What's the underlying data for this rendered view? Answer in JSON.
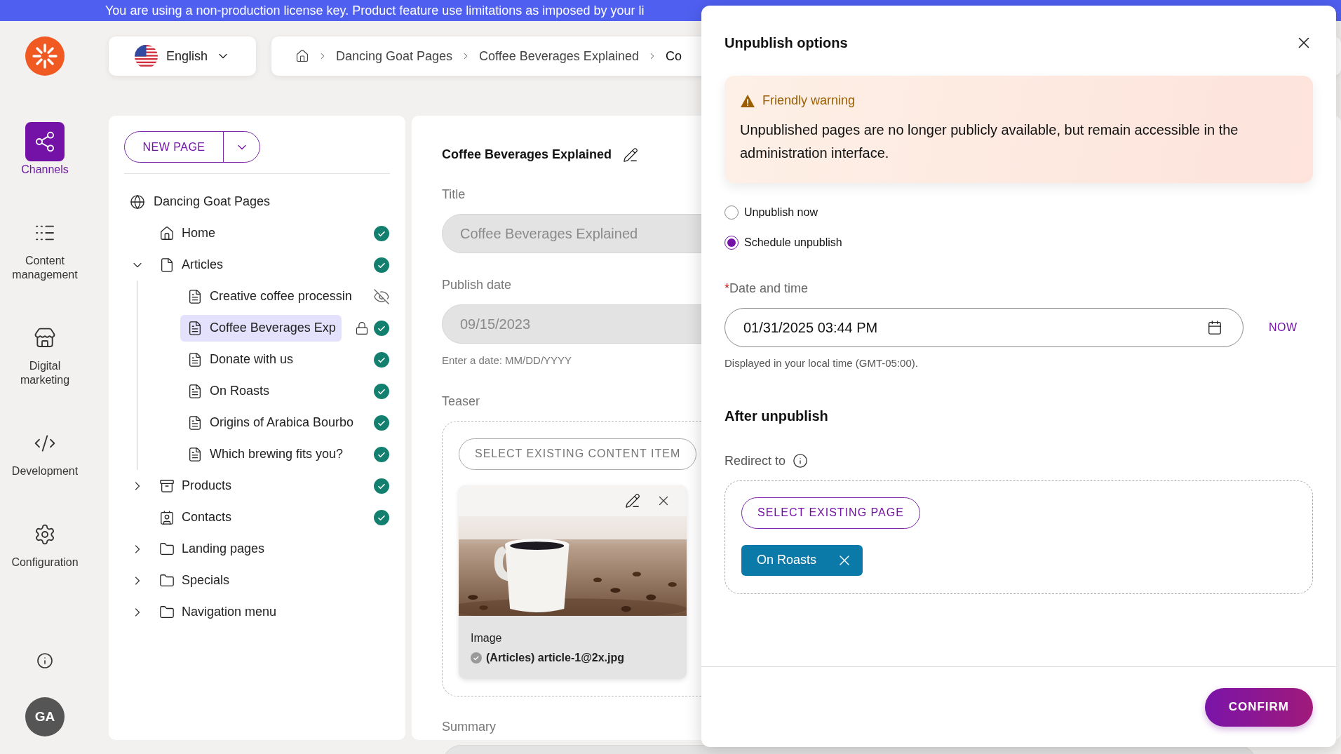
{
  "banner": {
    "text": "You are using a non-production license key. Product feature use limitations as imposed by your li"
  },
  "rail": {
    "items": [
      {
        "label": "Channels",
        "kind": "channels",
        "selected": true
      },
      {
        "label": "Content management",
        "kind": "content",
        "selected": false
      },
      {
        "label": "Digital marketing",
        "kind": "store",
        "selected": false
      },
      {
        "label": "Development",
        "kind": "code",
        "selected": false
      },
      {
        "label": "Configuration",
        "kind": "gears",
        "selected": false
      }
    ],
    "avatar": "GA"
  },
  "language": {
    "label": "English"
  },
  "breadcrumb": [
    "Dancing Goat Pages",
    "Coffee Beverages Explained",
    "Co"
  ],
  "tree": {
    "new_page": "NEW PAGE",
    "items": [
      {
        "label": "Dancing Goat Pages",
        "kind": "website",
        "selected": false,
        "children": [
          {
            "label": "Home",
            "kind": "home",
            "published": true,
            "selected": false
          },
          {
            "label": "Articles",
            "kind": "page",
            "published": true,
            "expanded": true,
            "selected": false,
            "children": [
              {
                "label": "Creative coffee processin",
                "kind": "article",
                "published": false,
                "hidden": true,
                "selected": false
              },
              {
                "label": "Coffee Beverages Exp",
                "kind": "article",
                "published": true,
                "locked": true,
                "selected": true
              },
              {
                "label": "Donate with us",
                "kind": "article",
                "published": true,
                "selected": false
              },
              {
                "label": "On Roasts",
                "kind": "article",
                "published": true,
                "selected": false
              },
              {
                "label": "Origins of Arabica Bourbo",
                "kind": "article",
                "published": true,
                "selected": false
              },
              {
                "label": "Which brewing fits you?",
                "kind": "article",
                "published": true,
                "selected": false
              }
            ]
          },
          {
            "label": "Products",
            "kind": "archive",
            "published": true,
            "expanded": false,
            "selected": false
          },
          {
            "label": "Contacts",
            "kind": "contacts",
            "published": true,
            "selected": false
          },
          {
            "label": "Landing pages",
            "kind": "folder",
            "expanded": false,
            "selected": false
          },
          {
            "label": "Specials",
            "kind": "folder",
            "expanded": false,
            "selected": false
          },
          {
            "label": "Navigation menu",
            "kind": "folder",
            "expanded": false,
            "selected": false
          }
        ]
      }
    ]
  },
  "editor": {
    "heading": "Coffee Beverages Explained",
    "fields": [
      {
        "label": "Title",
        "value": "Coffee Beverages Explained",
        "disabled": true
      },
      {
        "label": "Publish date",
        "value": "09/15/2023",
        "disabled": true,
        "hint": "Enter a date: MM/DD/YYYY"
      }
    ],
    "teaser": {
      "label": "Teaser",
      "button": "SELECT EXISTING CONTENT ITEM",
      "card": {
        "type": "Image",
        "name": "(Articles) article-1@2x.jpg"
      }
    },
    "summary_label": "Summary"
  },
  "dialog": {
    "title": "Unpublish options",
    "warning": {
      "title": "Friendly warning",
      "text": "Unpublished pages are no longer publicly available, but remain accessible in the administration interface."
    },
    "options": [
      {
        "label": "Unpublish now",
        "selected": false
      },
      {
        "label": "Schedule unpublish",
        "selected": true
      }
    ],
    "date": {
      "required_mark": "*",
      "label": "Date and time",
      "value": "01/31/2025 03:44 PM",
      "now": "NOW",
      "hint": "Displayed in your local time (GMT-05:00)."
    },
    "after": {
      "heading": "After unpublish",
      "redirect_label": "Redirect to",
      "button": "SELECT EXISTING PAGE",
      "chip": "On Roasts"
    },
    "confirm": "CONFIRM"
  }
}
